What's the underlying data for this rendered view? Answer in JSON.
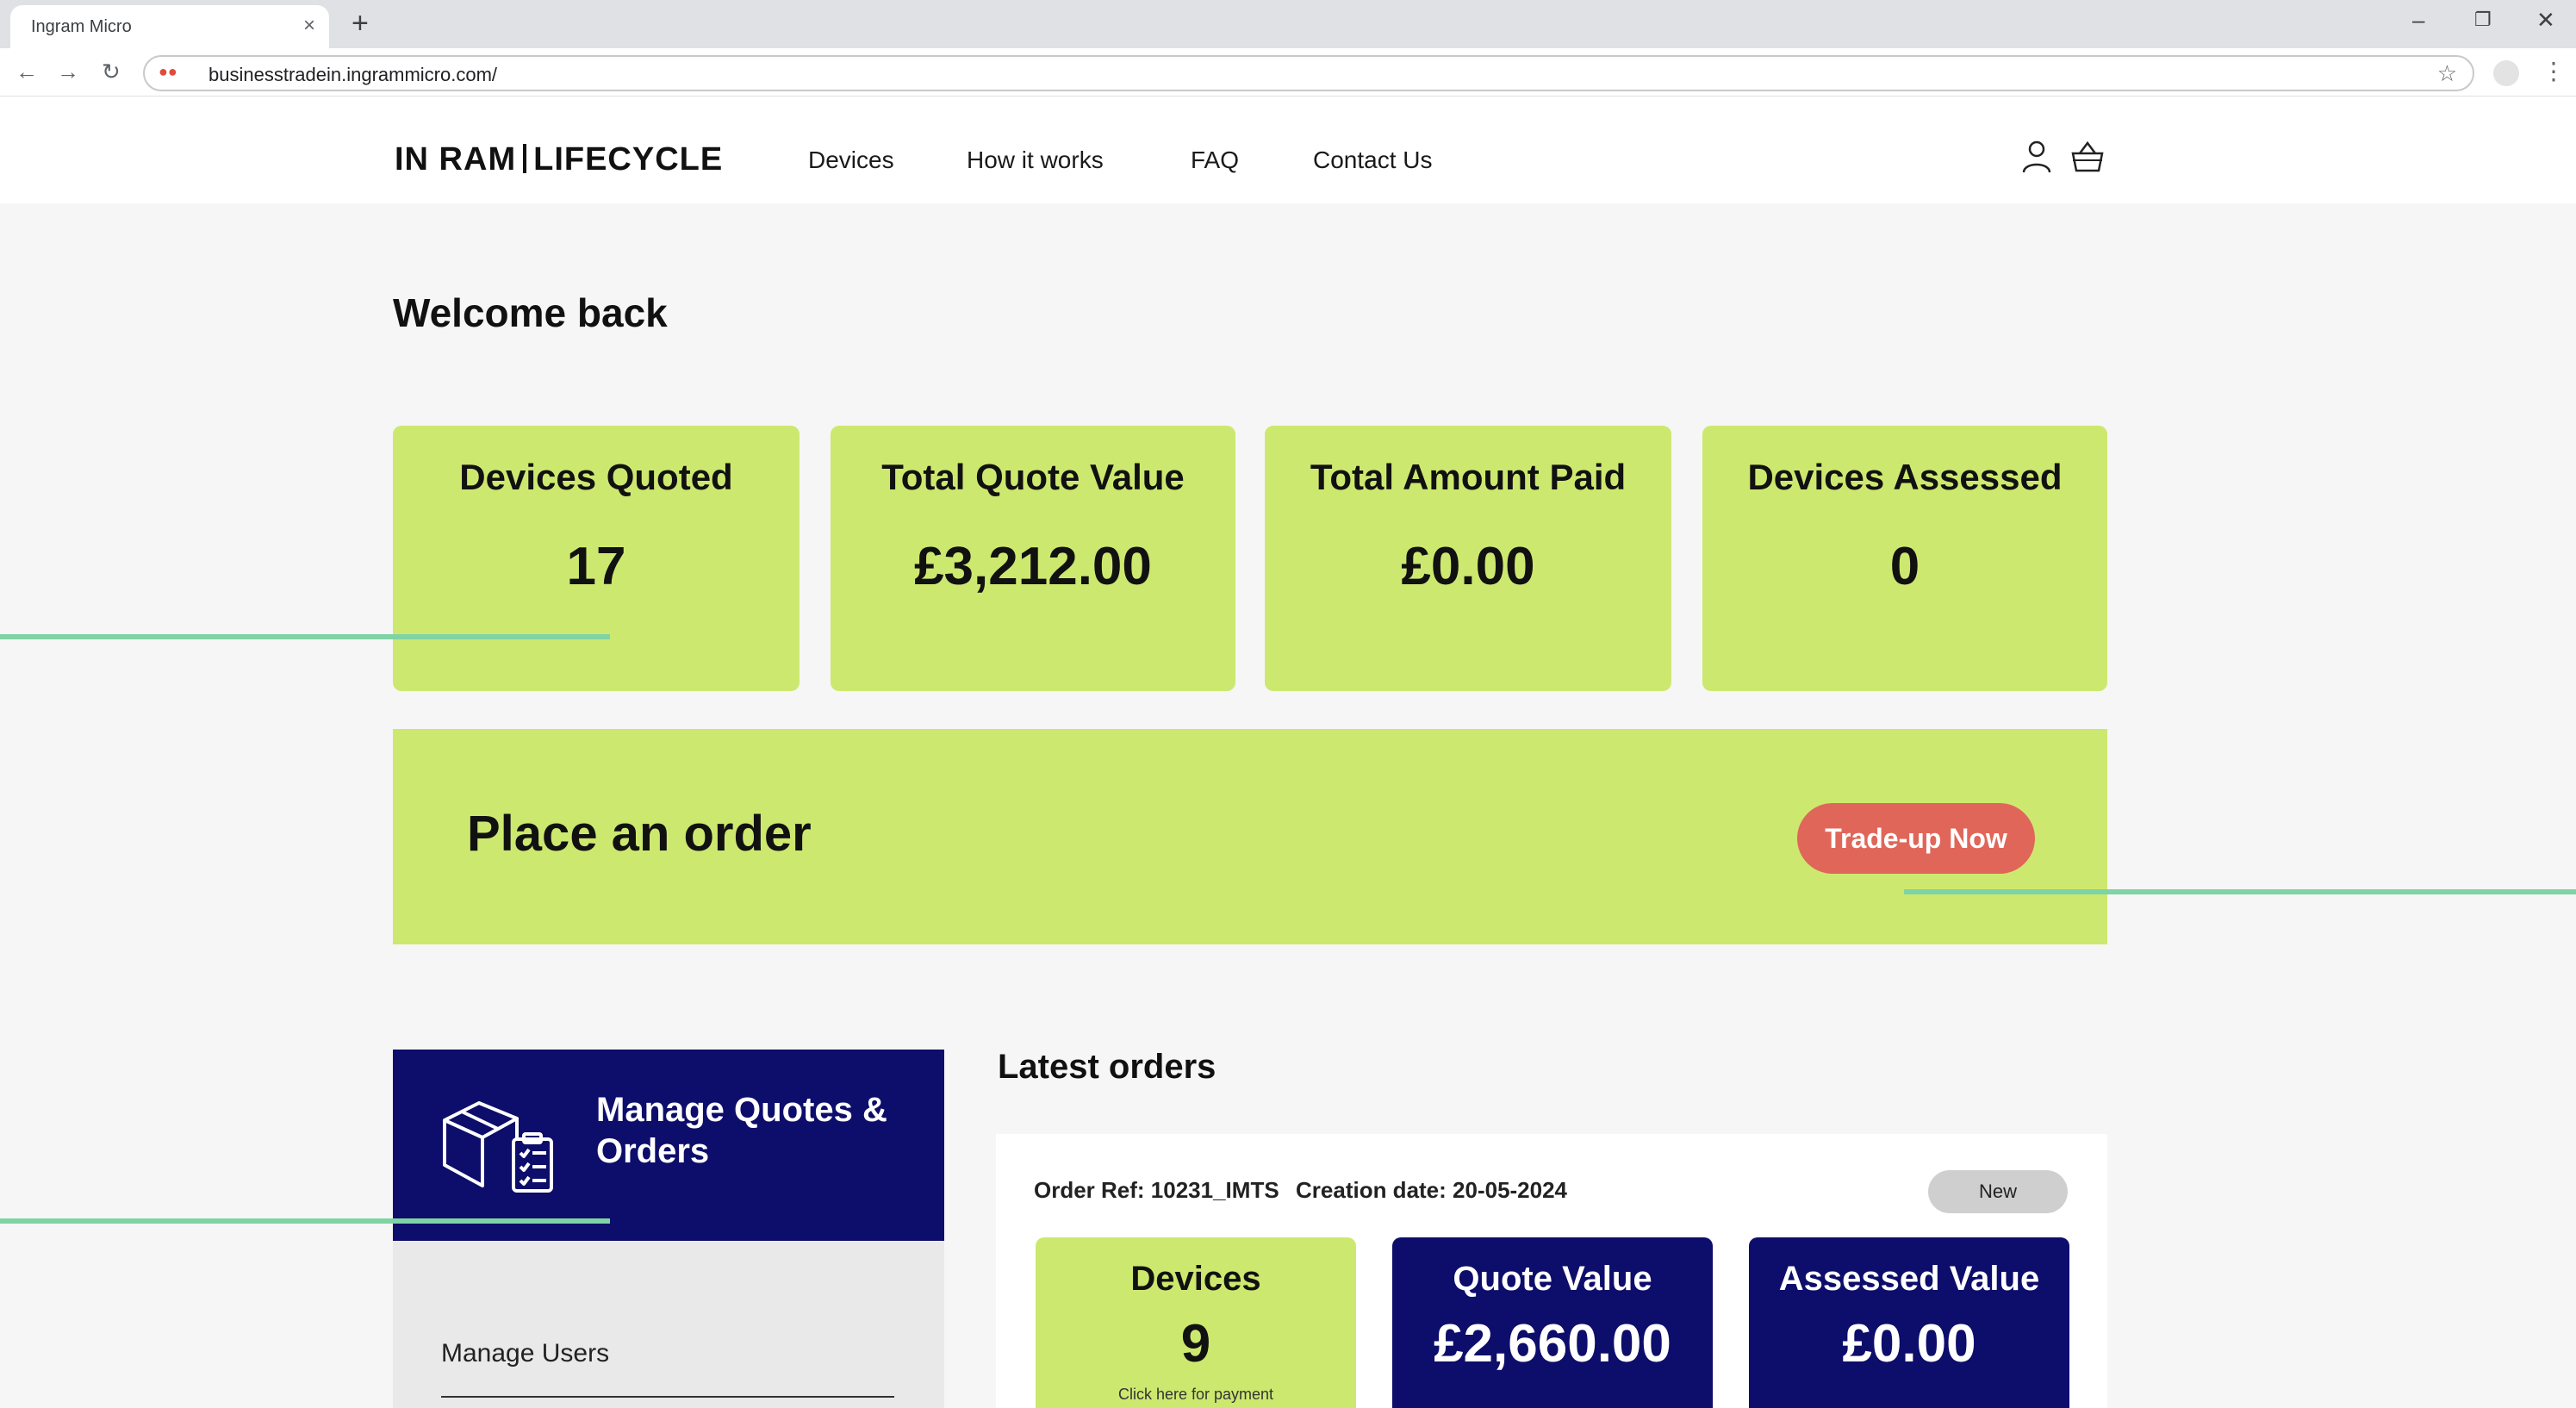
{
  "browser": {
    "tab_title": "Ingram Micro",
    "tab_close": "×",
    "new_tab": "+",
    "url": "businesstradein.ingrammicro.com/",
    "back": "←",
    "forward": "→",
    "reload": "↻",
    "star": "☆",
    "menu": "⋮",
    "minimize": "–",
    "restore": "❐",
    "close": "✕"
  },
  "header": {
    "logo_left": "IN RAM",
    "logo_right": "LIFECYCLE",
    "nav": [
      "Devices",
      "How it works",
      "FAQ",
      "Contact Us"
    ],
    "icons": [
      "user-icon",
      "basket-icon"
    ]
  },
  "welcome": "Welcome back",
  "stats": [
    {
      "label": "Devices Quoted",
      "value": "17"
    },
    {
      "label": "Total Quote Value",
      "value": "£3,212.00"
    },
    {
      "label": "Total Amount Paid",
      "value": "£0.00"
    },
    {
      "label": "Devices Assessed",
      "value": "0"
    }
  ],
  "order_banner": {
    "title": "Place an order",
    "button": "Trade-up Now"
  },
  "manage": {
    "title": "Manage Quotes & Orders",
    "icon": "box-clipboard-icon",
    "menu_item": "Manage Users"
  },
  "latest_orders": {
    "title": "Latest orders",
    "order_ref": "Order Ref: 10231_IMTS",
    "creation_date": "Creation date: 20-05-2024",
    "status": "New",
    "cards": [
      {
        "label": "Devices",
        "value": "9",
        "hint": "Click here for payment",
        "style": "green"
      },
      {
        "label": "Quote Value",
        "value": "£2,660.00",
        "style": "navy"
      },
      {
        "label": "Assessed Value",
        "value": "£0.00",
        "style": "navy"
      }
    ]
  },
  "colors": {
    "lime": "#cde86f",
    "navy": "#0d0d6b",
    "coral": "#e1665a",
    "callout": "#7fd3a4"
  }
}
